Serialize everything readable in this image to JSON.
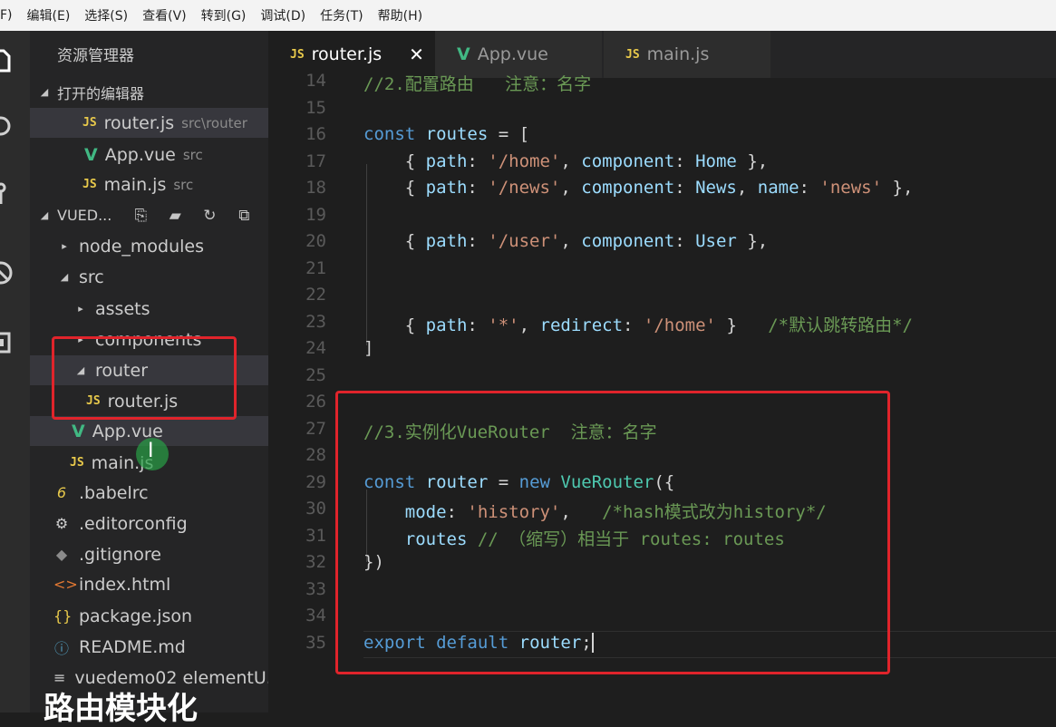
{
  "menu": [
    "F)",
    "编辑(E)",
    "选择(S)",
    "查看(V)",
    "转到(G)",
    "调试(D)",
    "任务(T)",
    "帮助(H)"
  ],
  "colors": {
    "accent_red": "#e0242b",
    "js_icon": "#e8c94b",
    "vue_icon": "#41b883"
  },
  "activity_icons": [
    "files-icon",
    "search-icon",
    "source-control-icon",
    "debug-icon",
    "extensions-icon"
  ],
  "sidebar": {
    "title": "资源管理器",
    "open_editors_label": "打开的编辑器",
    "open_editors": [
      {
        "icon": "JS",
        "name": "router.js",
        "hint": "src\\router"
      },
      {
        "icon": "V",
        "name": "App.vue",
        "hint": "src"
      },
      {
        "icon": "JS",
        "name": "main.js",
        "hint": "src"
      }
    ],
    "project_label": "VUED...",
    "tree": [
      {
        "name": "node_modules",
        "icon": "▸"
      },
      {
        "name": "src",
        "icon": "◢"
      },
      {
        "name": "assets",
        "icon": "▸"
      },
      {
        "name": "components",
        "icon": "▸"
      },
      {
        "name": "router",
        "icon": "◢"
      },
      {
        "name": "router.js",
        "icon": "JS"
      },
      {
        "name": "App.vue",
        "icon": "V"
      },
      {
        "name": "main.js",
        "icon": "JS"
      },
      {
        "name": ".babelrc",
        "icon": "6"
      },
      {
        "name": ".editorconfig",
        "icon": "⚙"
      },
      {
        "name": ".gitignore",
        "icon": "◆"
      },
      {
        "name": "index.html",
        "icon": "<>"
      },
      {
        "name": "package.json",
        "icon": "{}"
      },
      {
        "name": "README.md",
        "icon": "ⓘ"
      },
      {
        "name": "vuedemo02 elementU...",
        "icon": "≡"
      }
    ]
  },
  "tabs": [
    {
      "icon": "JS",
      "label": "router.js",
      "close": "✕"
    },
    {
      "icon": "V",
      "label": "App.vue"
    },
    {
      "icon": "JS",
      "label": "main.js"
    }
  ],
  "editor": {
    "lines": [
      {
        "n": "14",
        "text": "//2.配置路由   注意：名字"
      },
      {
        "n": "15",
        "text": ""
      },
      {
        "n": "16",
        "text": "const routes = ["
      },
      {
        "n": "17",
        "text": "    { path: '/home', component: Home },"
      },
      {
        "n": "18",
        "text": "    { path: '/news', component: News, name: 'news' },"
      },
      {
        "n": "19",
        "text": ""
      },
      {
        "n": "20",
        "text": "    { path: '/user', component: User },"
      },
      {
        "n": "21",
        "text": ""
      },
      {
        "n": "22",
        "text": ""
      },
      {
        "n": "23",
        "text": "    { path: '*', redirect: '/home' }   /*默认跳转路由*/"
      },
      {
        "n": "24",
        "text": "]"
      },
      {
        "n": "25",
        "text": ""
      },
      {
        "n": "26",
        "text": ""
      },
      {
        "n": "27",
        "text": "//3.实例化VueRouter  注意：名字"
      },
      {
        "n": "28",
        "text": ""
      },
      {
        "n": "29",
        "text": "const router = new VueRouter({"
      },
      {
        "n": "30",
        "text": "    mode: 'history',   /*hash模式改为history*/"
      },
      {
        "n": "31",
        "text": "    routes // （缩写）相当于 routes: routes"
      },
      {
        "n": "32",
        "text": "})"
      },
      {
        "n": "33",
        "text": ""
      },
      {
        "n": "34",
        "text": ""
      },
      {
        "n": "35",
        "text": "export default router;"
      }
    ]
  },
  "caption": "路由模块化"
}
